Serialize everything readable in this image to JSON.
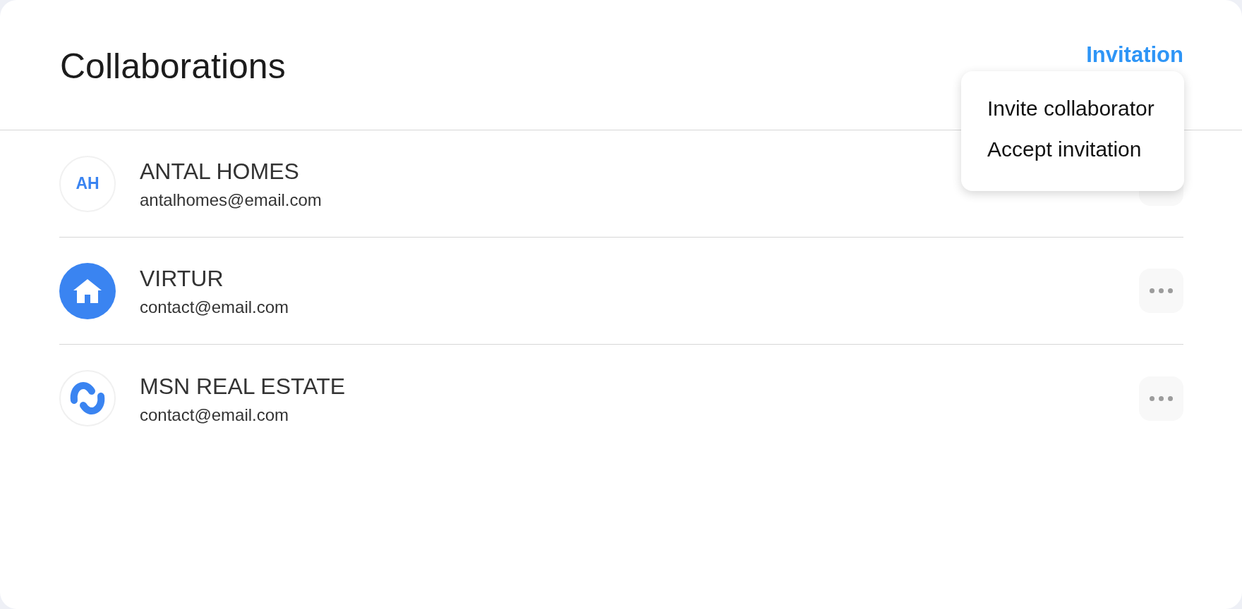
{
  "header": {
    "title": "Collaborations",
    "invitation": {
      "label": "Invitation",
      "expanded": true,
      "menu": [
        {
          "label": "Invite collaborator"
        },
        {
          "label": "Accept invitation"
        }
      ]
    }
  },
  "collaborators": [
    {
      "name": "ANTAL HOMES",
      "email": "antalhomes@email.com",
      "avatar": {
        "kind": "initials",
        "initials": "AH"
      }
    },
    {
      "name": "VIRTUR",
      "email": "contact@email.com",
      "avatar": {
        "kind": "house"
      }
    },
    {
      "name": "MSN REAL ESTATE",
      "email": "contact@email.com",
      "avatar": {
        "kind": "swirl"
      }
    }
  ]
}
